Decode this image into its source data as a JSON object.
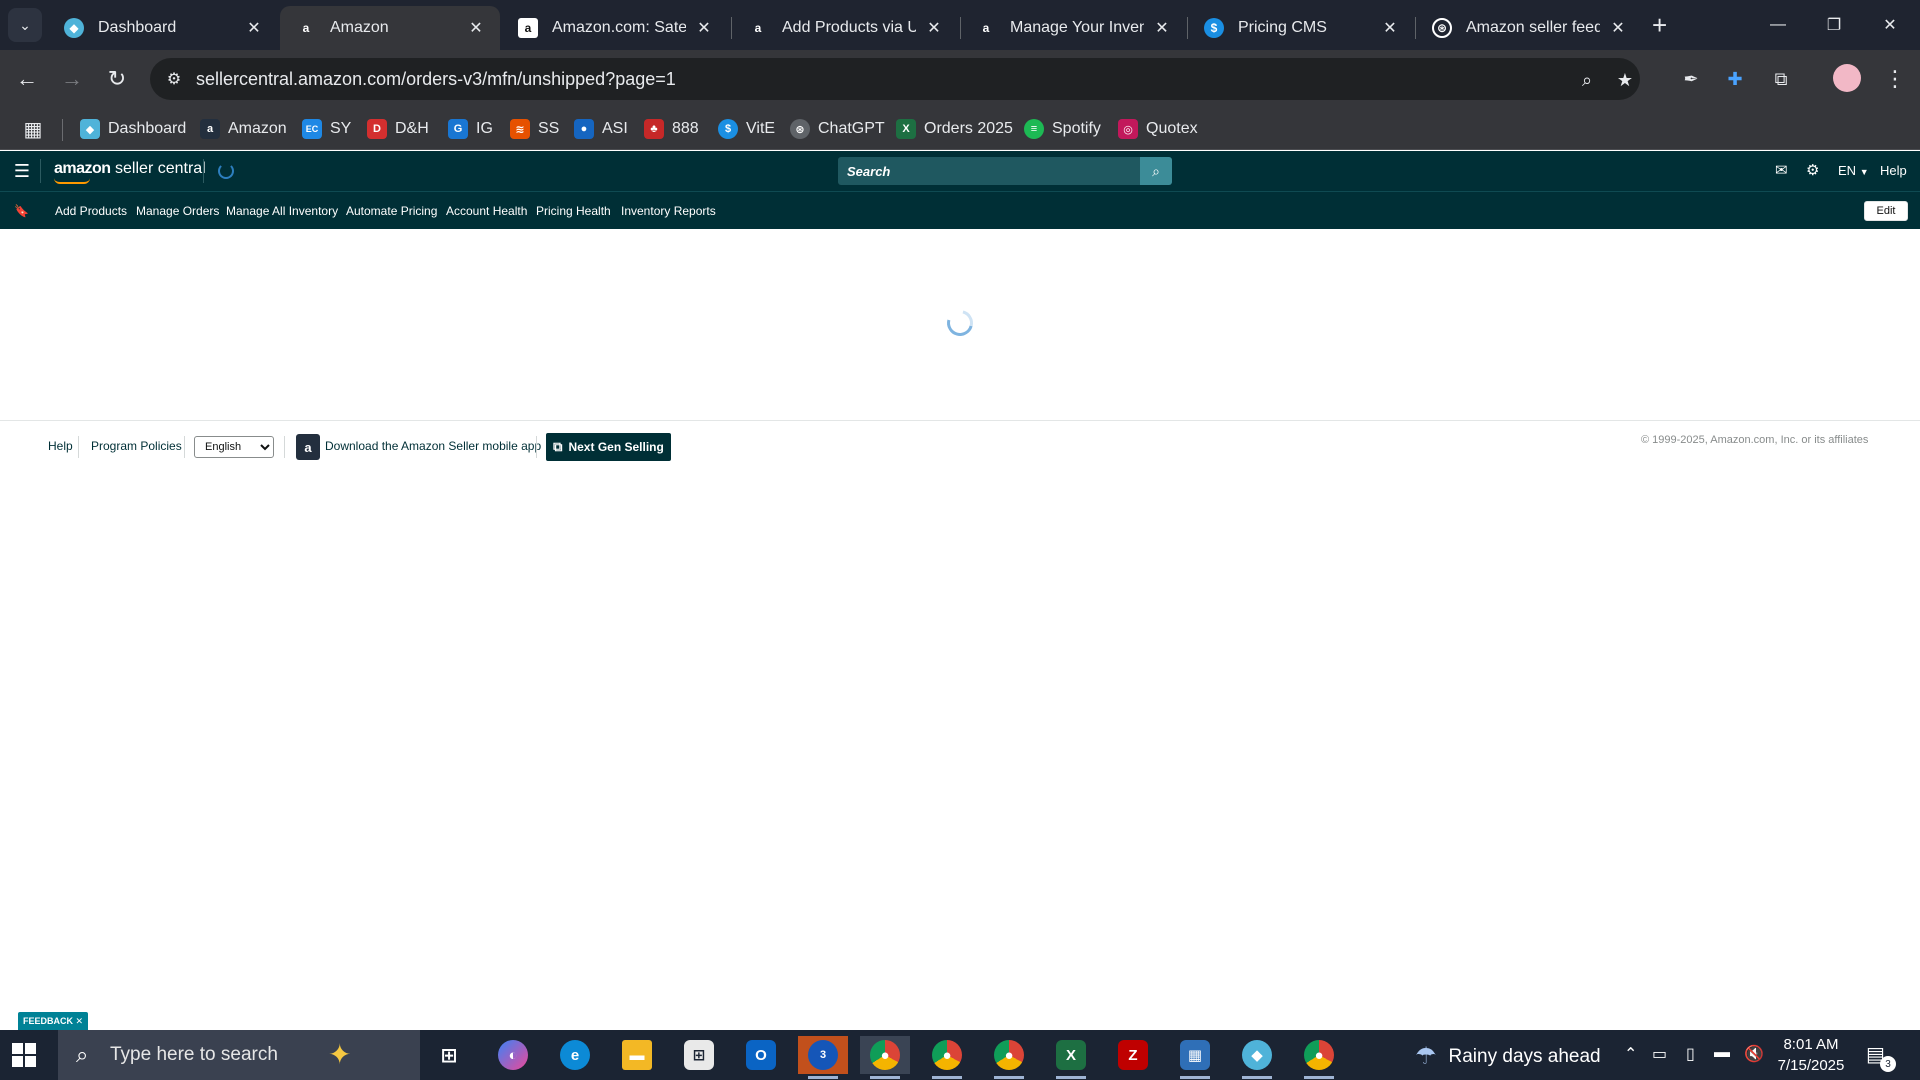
{
  "browser": {
    "tabs": [
      {
        "title": "Dashboard",
        "icon": "hexagon-icon",
        "color": "#4fb3d9"
      },
      {
        "title": "Amazon",
        "icon": "amazon-icon",
        "color": "#232f3e"
      },
      {
        "title": "Amazon.com: Satechi",
        "icon": "amazon-icon",
        "color": "#ffffff"
      },
      {
        "title": "Add Products via Upl",
        "icon": "amazon-icon",
        "color": "#232f3e"
      },
      {
        "title": "Manage Your Invento",
        "icon": "amazon-icon",
        "color": "#232f3e"
      },
      {
        "title": "Pricing CMS",
        "icon": "dollar-icon",
        "color": "#1a8fe3"
      },
      {
        "title": "Amazon seller feedb",
        "icon": "openai-icon",
        "color": "#ffffff"
      }
    ],
    "active_tab": 1,
    "url": "sellercentral.amazon.com/orders-v3/mfn/unshipped?page=1",
    "bookmarks": [
      {
        "label": "Dashboard",
        "color": "#4fb3d9",
        "glyph": "◆"
      },
      {
        "label": "Amazon",
        "color": "#232f3e",
        "glyph": "a"
      },
      {
        "label": "SY",
        "color": "#1e88e5",
        "glyph": "EC"
      },
      {
        "label": "D&H",
        "color": "#d32f2f",
        "glyph": "D"
      },
      {
        "label": "IG",
        "color": "#1976d2",
        "glyph": "G"
      },
      {
        "label": "SS",
        "color": "#e65100",
        "glyph": "≋"
      },
      {
        "label": "ASI",
        "color": "#1565c0",
        "glyph": "●"
      },
      {
        "label": "888",
        "color": "#c62828",
        "glyph": "♣"
      },
      {
        "label": "VitE",
        "color": "#1a8fe3",
        "glyph": "$"
      },
      {
        "label": "ChatGPT",
        "color": "#5f6368",
        "glyph": "⊛"
      },
      {
        "label": "Orders 2025",
        "color": "#1d6f42",
        "glyph": "X"
      },
      {
        "label": "Spotify",
        "color": "#1db954",
        "glyph": "≡"
      },
      {
        "label": "Quotex",
        "color": "#c2185b",
        "glyph": "◎"
      }
    ]
  },
  "seller_central": {
    "logo_brand": "amazon",
    "logo_suffix": "seller central",
    "search_placeholder": "Search",
    "language": "EN",
    "help": "Help",
    "nav": [
      "Add Products",
      "Manage Orders",
      "Manage All Inventory",
      "Automate Pricing",
      "Account Health",
      "Pricing Health",
      "Inventory Reports"
    ],
    "edit": "Edit"
  },
  "footer": {
    "help": "Help",
    "program_policies": "Program Policies",
    "language_selected": "English",
    "app_link": "Download the Amazon Seller mobile app",
    "next_gen": "Next Gen Selling",
    "copyright": "© 1999-2025, Amazon.com, Inc. or its affiliates"
  },
  "feedback": "FEEDBACK",
  "taskbar": {
    "search_placeholder": "Type here to search",
    "weather": "Rainy days ahead",
    "time": "8:01 AM",
    "date": "7/15/2025",
    "notification_count": "3",
    "app_badge": "3"
  }
}
